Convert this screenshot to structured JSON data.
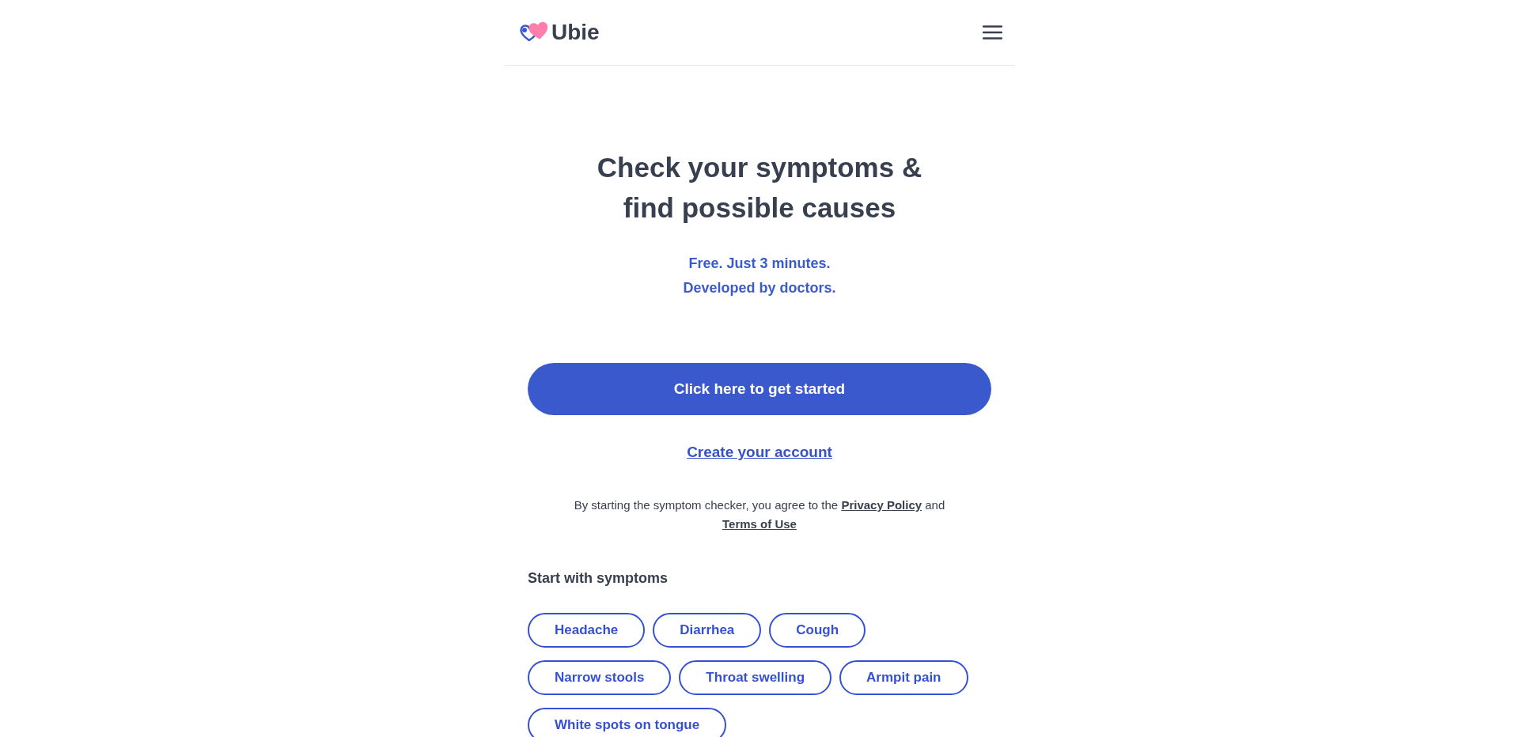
{
  "header": {
    "logo_text": "Ubie"
  },
  "hero": {
    "title_lines": [
      "Check your symptoms &",
      "find possible causes"
    ],
    "subtitle_lines": [
      "Free. Just 3 minutes.",
      "Developed by doctors."
    ]
  },
  "cta_button": "Click here to get started",
  "account_link": "Create your account",
  "consent": {
    "text_before": "By starting the symptom checker, you agree to the",
    "privacy_link": "Privacy Policy",
    "text_between": "and",
    "terms_link": "Terms of Use"
  },
  "symptoms": {
    "heading": "Start with symptoms",
    "chips": [
      "Headache",
      "Diarrhea",
      "Cough",
      "Narrow stools",
      "Throat swelling",
      "Armpit pain",
      "White spots on tongue"
    ]
  }
}
